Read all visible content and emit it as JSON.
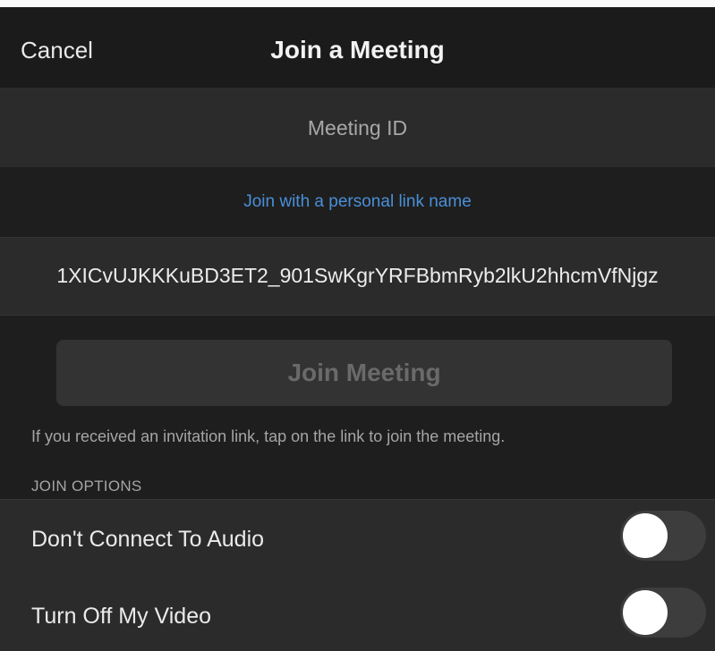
{
  "nav": {
    "cancel_label": "Cancel",
    "title": "Join a Meeting"
  },
  "meeting_id": {
    "placeholder": "Meeting ID",
    "value": ""
  },
  "personal_link": {
    "label": "Join with a personal link name"
  },
  "name_field": {
    "value": "1XICvUJKKKuBD3ET2_901SwKgrYRFBbmRyb2lkU2hhcmVfNjgz"
  },
  "join_button": {
    "label": "Join Meeting",
    "enabled": false
  },
  "hint": "If you received an invitation link, tap on the link to join the meeting.",
  "join_options": {
    "header": "JOIN OPTIONS",
    "items": [
      {
        "label": "Don't Connect To Audio",
        "on": false
      },
      {
        "label": "Turn Off My Video",
        "on": false
      }
    ]
  },
  "colors": {
    "background": "#1e1e1e",
    "field_background": "#2b2b2b",
    "link": "#4a8fd8",
    "toggle_off": "#3d3d3d"
  }
}
